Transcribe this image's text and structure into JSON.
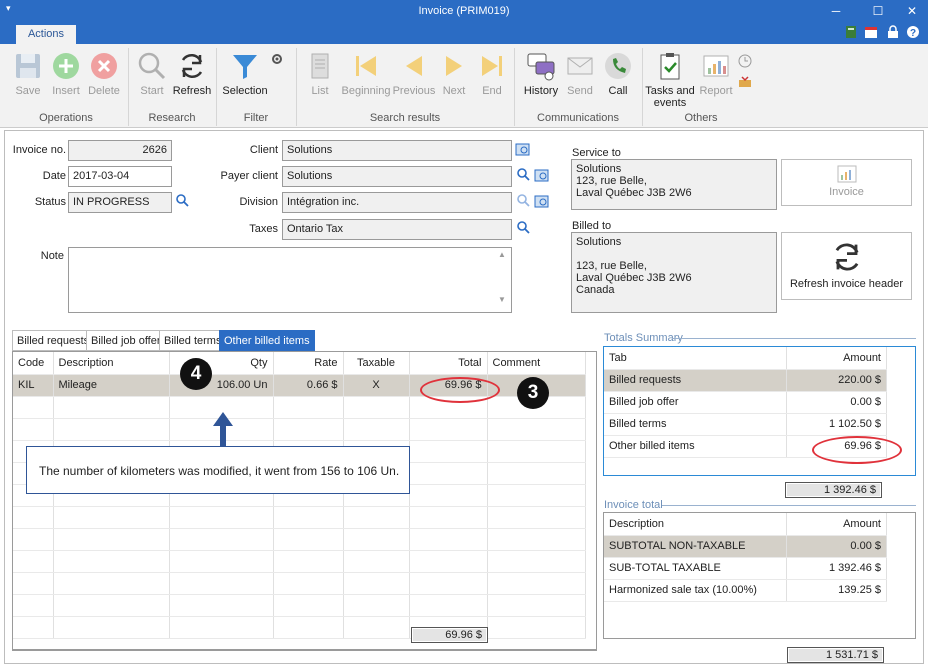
{
  "window": {
    "title": "Invoice (PRIM019)",
    "tab": "Actions"
  },
  "ribbon": {
    "operations": {
      "save": "Save",
      "insert": "Insert",
      "delete": "Delete",
      "group": "Operations"
    },
    "research": {
      "start": "Start",
      "refresh": "Refresh",
      "group": "Research"
    },
    "filter": {
      "selection": "Selection",
      "group": "Filter"
    },
    "search_results": {
      "list": "List",
      "beginning": "Beginning",
      "previous": "Previous",
      "next": "Next",
      "end": "End",
      "group": "Search results"
    },
    "communications": {
      "history": "History",
      "send": "Send",
      "call": "Call",
      "group": "Communications"
    },
    "others": {
      "tasks": "Tasks and events",
      "report": "Report",
      "group": "Others"
    }
  },
  "form": {
    "invoice_no_label": "Invoice no.",
    "invoice_no": "2626",
    "date_label": "Date",
    "date": "2017-03-04",
    "status_label": "Status",
    "status": "IN PROGRESS",
    "note_label": "Note",
    "note": "",
    "client_label": "Client",
    "client": "Solutions",
    "payer_label": "Payer client",
    "payer": "Solutions",
    "division_label": "Division",
    "division": "Intégration inc.",
    "taxes_label": "Taxes",
    "taxes": "Ontario Tax"
  },
  "service_to": {
    "label": "Service to",
    "address": "Solutions\n123, rue Belle,\nLaval Québec J3B 2W6"
  },
  "billed_to": {
    "label": "Billed to",
    "address": "Solutions\n\n123, rue Belle,\nLaval Québec J3B 2W6\nCanada"
  },
  "buttons": {
    "invoice": "Invoice",
    "refresh_header": "Refresh invoice header"
  },
  "subtabs": [
    "Billed requests",
    "Billed job offer",
    "Billed terms",
    "Other billed items"
  ],
  "items": {
    "headers": [
      "Code",
      "Description",
      "Qty",
      "Rate",
      "Taxable",
      "Total",
      "Comment"
    ],
    "rows": [
      [
        "KIL",
        "Mileage",
        "106.00 Un",
        "0.66 $",
        "X",
        "69.96 $",
        ""
      ]
    ],
    "footer_total": "69.96 $"
  },
  "annotation": {
    "text": "The number of kilometers was modified, it went from 156 to 106 Un.",
    "badge_qty": "4",
    "badge_total": "3"
  },
  "totals_summary": {
    "title": "Totals Summary",
    "headers": [
      "Tab",
      "Amount"
    ],
    "rows": [
      [
        "Billed requests",
        "220.00 $"
      ],
      [
        "Billed job offer",
        "0.00 $"
      ],
      [
        "Billed terms",
        "1 102.50 $"
      ],
      [
        "Other billed items",
        "69.96 $"
      ]
    ],
    "total": "1 392.46 $"
  },
  "invoice_total": {
    "title": "Invoice total",
    "headers": [
      "Description",
      "Amount"
    ],
    "rows": [
      [
        "SUBTOTAL NON-TAXABLE",
        "0.00 $"
      ],
      [
        "SUB-TOTAL TAXABLE",
        "1 392.46 $"
      ],
      [
        "Harmonized sale tax (10.00%)",
        "139.25 $"
      ]
    ],
    "total": "1 531.71 $"
  },
  "colors": {
    "accent": "#2b6cc4",
    "highlight_oval": "#e0323b",
    "selected_row": "#d4d0c8"
  }
}
